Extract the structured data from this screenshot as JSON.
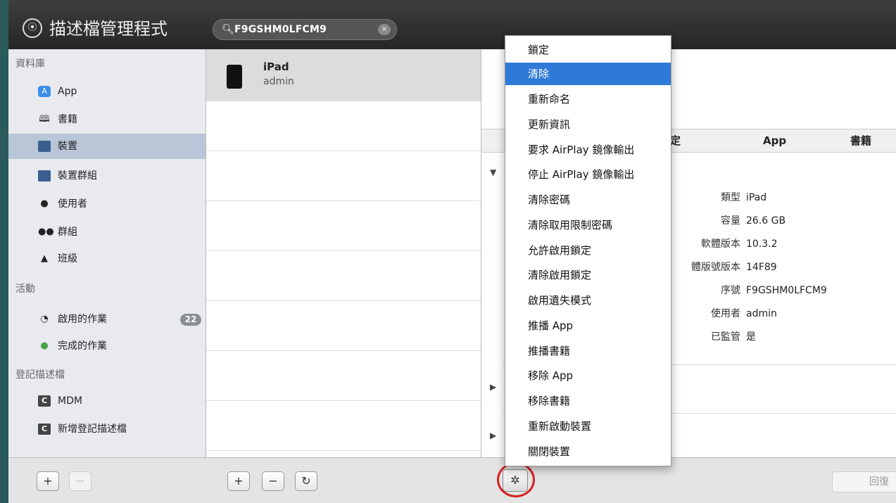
{
  "app": {
    "title": "描述檔管理程式",
    "logo_glyph": "⦿"
  },
  "search": {
    "value": "F9GSHM0LFCM9",
    "icon": "search-icon",
    "clear": "×"
  },
  "sidebar": {
    "sections": [
      {
        "label": "資料庫"
      },
      {
        "label": "活動"
      },
      {
        "label": "登記描述檔"
      }
    ],
    "items": [
      {
        "label": "App",
        "icon": "app-store-icon",
        "glyph": "A"
      },
      {
        "label": "書籍",
        "icon": "book-icon",
        "glyph": "📖"
      },
      {
        "label": "裝置",
        "icon": "device-icon",
        "glyph": ""
      },
      {
        "label": "裝置群組",
        "icon": "device-group-icon",
        "glyph": ""
      },
      {
        "label": "使用者",
        "icon": "user-icon",
        "glyph": "👤"
      },
      {
        "label": "群組",
        "icon": "group-icon",
        "glyph": "👥"
      },
      {
        "label": "班級",
        "icon": "class-icon",
        "glyph": "🎓"
      },
      {
        "label": "啟用的作業",
        "icon": "active-tasks-icon",
        "glyph": "◔",
        "badge": "22"
      },
      {
        "label": "完成的作業",
        "icon": "completed-tasks-icon",
        "glyph": "●"
      },
      {
        "label": "MDM",
        "icon": "mdm-icon",
        "glyph": "C"
      },
      {
        "label": "新增登記描述檔",
        "icon": "enrollment-profile-icon",
        "glyph": "C"
      }
    ]
  },
  "list": {
    "items": [
      {
        "title": "iPad",
        "subtitle": "admin"
      }
    ]
  },
  "detail": {
    "columns": [
      "定",
      "App",
      "書籍"
    ],
    "info": [
      {
        "key": "類型",
        "value": "iPad"
      },
      {
        "key": "容量",
        "value": "26.6 GB"
      },
      {
        "key": "軟體版本",
        "value": "10.3.2"
      },
      {
        "key": "體版號版本",
        "value": "14F89"
      },
      {
        "key": "序號",
        "value": "F9GSHM0LFCM9"
      },
      {
        "key": "使用者",
        "value": "admin"
      },
      {
        "key": "已監管",
        "value": "是"
      }
    ],
    "back_label": "回復"
  },
  "menu": {
    "items": [
      "鎖定",
      "清除",
      "重新命名",
      "更新資訊",
      "要求 AirPlay 鏡像輸出",
      "停止 AirPlay 鏡像輸出",
      "清除密碼",
      "清除取用限制密碼",
      "允許啟用鎖定",
      "清除啟用鎖定",
      "啟用遺失模式",
      "推播 App",
      "推播書籍",
      "移除 App",
      "移除書籍",
      "重新啟動裝置",
      "關閉裝置"
    ],
    "highlighted_index": 1
  },
  "toolbar": {
    "add": "+",
    "remove": "−",
    "refresh": "↻",
    "gear": "✲"
  },
  "colors": {
    "highlight": "#2f7ad6",
    "sidebar_selected": "#b8c6d8",
    "annotation_circle": "#d52020"
  }
}
